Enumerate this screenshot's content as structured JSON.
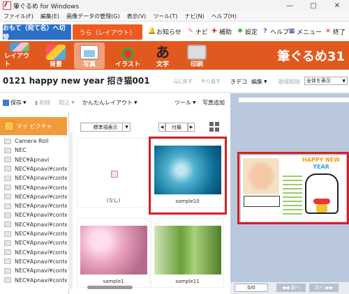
{
  "window": {
    "title": "筆ぐるめ for Windows"
  },
  "menubar": [
    "ファイル(F)",
    "編集(E)",
    "画像データの管理(G)",
    "表示(V)",
    "ツール(T)",
    "ナビ(N)",
    "ヘルプ(H)"
  ],
  "mode_tabs": {
    "front": "おもて（宛て名）へ切替",
    "back": "うら（レイアウト）"
  },
  "top_actions": {
    "notice": "お知らせ",
    "navi": "ナビ",
    "assist": "補助",
    "settings": "設定",
    "help": "ヘルプ",
    "menu": "メニュー",
    "exit": "終了"
  },
  "ribbon": {
    "items": [
      {
        "label": "レイアウト",
        "selected": false
      },
      {
        "label": "背景",
        "selected": false
      },
      {
        "label": "写真",
        "selected": true
      },
      {
        "label": "イラスト",
        "selected": false
      },
      {
        "label": "文字",
        "selected": false
      },
      {
        "label": "印刷",
        "selected": false
      }
    ],
    "logo": "筆ぐるめ31"
  },
  "document": {
    "title": "0121  happy new year  招き猫001",
    "undo": "元に戻す",
    "redo": "やり直す"
  },
  "toolbar": {
    "save": "保存",
    "delete": "削除",
    "import": "取込",
    "easy_layout": "かんたんレイアウト",
    "tools": "ツール",
    "add_photo": "写真追加"
  },
  "right_toolbar": {
    "deco": "きデコ",
    "edit": "編集",
    "area_delete": "領域削除",
    "zoom": "全体を表示"
  },
  "folders": {
    "root": "マイ ピクチャ",
    "items": [
      "Camera Roll",
      "NEC",
      "NEC¥Apnavi",
      "NEC¥Apnavi¥contents",
      "NEC¥Apnavi¥conten...",
      "NEC¥Apnavi¥conten...",
      "NEC¥Apnavi¥conten...",
      "NEC¥Apnavi¥conten...",
      "NEC¥Apnavi¥conten...",
      "NEC¥Apnavi¥conten...",
      "NEC¥Apnavi¥conten...",
      "NEC¥Apnavi¥conten...",
      "NEC¥Apnavi¥conten...",
      "NEC¥Apnavi¥conten...",
      "NEC¥Apnavi¥conten...",
      "NEC¥Apnavi¥conten..."
    ]
  },
  "grid": {
    "view_mode": "標準項表示",
    "sort": "付羅",
    "items": [
      {
        "caption": "(なし)",
        "selected": false
      },
      {
        "caption": "sample10",
        "selected": true
      },
      {
        "caption": "sample1",
        "selected": false
      },
      {
        "caption": "sample11",
        "selected": false
      }
    ]
  },
  "card": {
    "banner_line1": "HAPPY NEW",
    "banner_line2": "YEAR"
  },
  "pager": {
    "count": "0/0",
    "prev": "◀◀ 前へ",
    "next": "次へ ▶▶"
  },
  "colors": {
    "ribbon": "#e2591f",
    "front_tab": "#2b6fc7",
    "selection": "#d42020",
    "folder_root": "#f39a3b"
  }
}
